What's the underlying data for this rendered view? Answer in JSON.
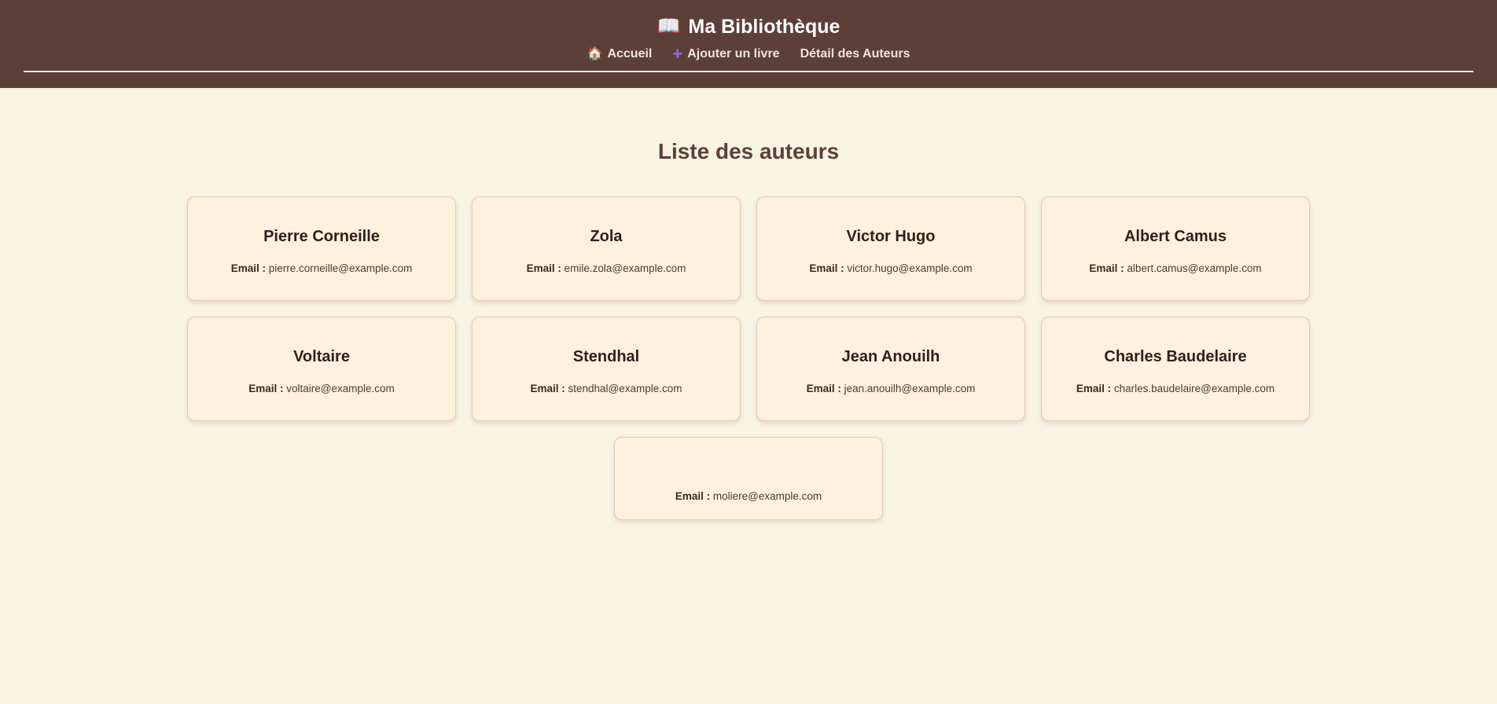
{
  "header": {
    "title": "Ma Bibliothèque",
    "title_icon": "book-icon",
    "nav": [
      {
        "label": "Accueil",
        "icon": "house-icon"
      },
      {
        "label": "Ajouter un livre",
        "icon": "plus-icon",
        "icon_color": "#8a6df0"
      },
      {
        "label": "Détail des Auteurs",
        "icon": ""
      }
    ]
  },
  "main": {
    "title": "Liste des auteurs",
    "email_label": "Email :",
    "authors": [
      {
        "name": "Pierre Corneille",
        "email": "pierre.corneille@example.com"
      },
      {
        "name": "Zola",
        "email": "emile.zola@example.com"
      },
      {
        "name": "Victor Hugo",
        "email": "victor.hugo@example.com"
      },
      {
        "name": "Albert Camus",
        "email": "albert.camus@example.com"
      },
      {
        "name": "Voltaire",
        "email": "voltaire@example.com"
      },
      {
        "name": "Stendhal",
        "email": "stendhal@example.com"
      },
      {
        "name": "Jean Anouilh",
        "email": "jean.anouilh@example.com"
      },
      {
        "name": "Charles Baudelaire",
        "email": "charles.baudelaire@example.com"
      },
      {
        "name": "",
        "email": "moliere@example.com"
      }
    ]
  },
  "colors": {
    "header_bg": "#5d3f39",
    "page_bg": "#f8f3e3",
    "card_bg": "#fff1de",
    "title_color": "#5d3f39"
  }
}
